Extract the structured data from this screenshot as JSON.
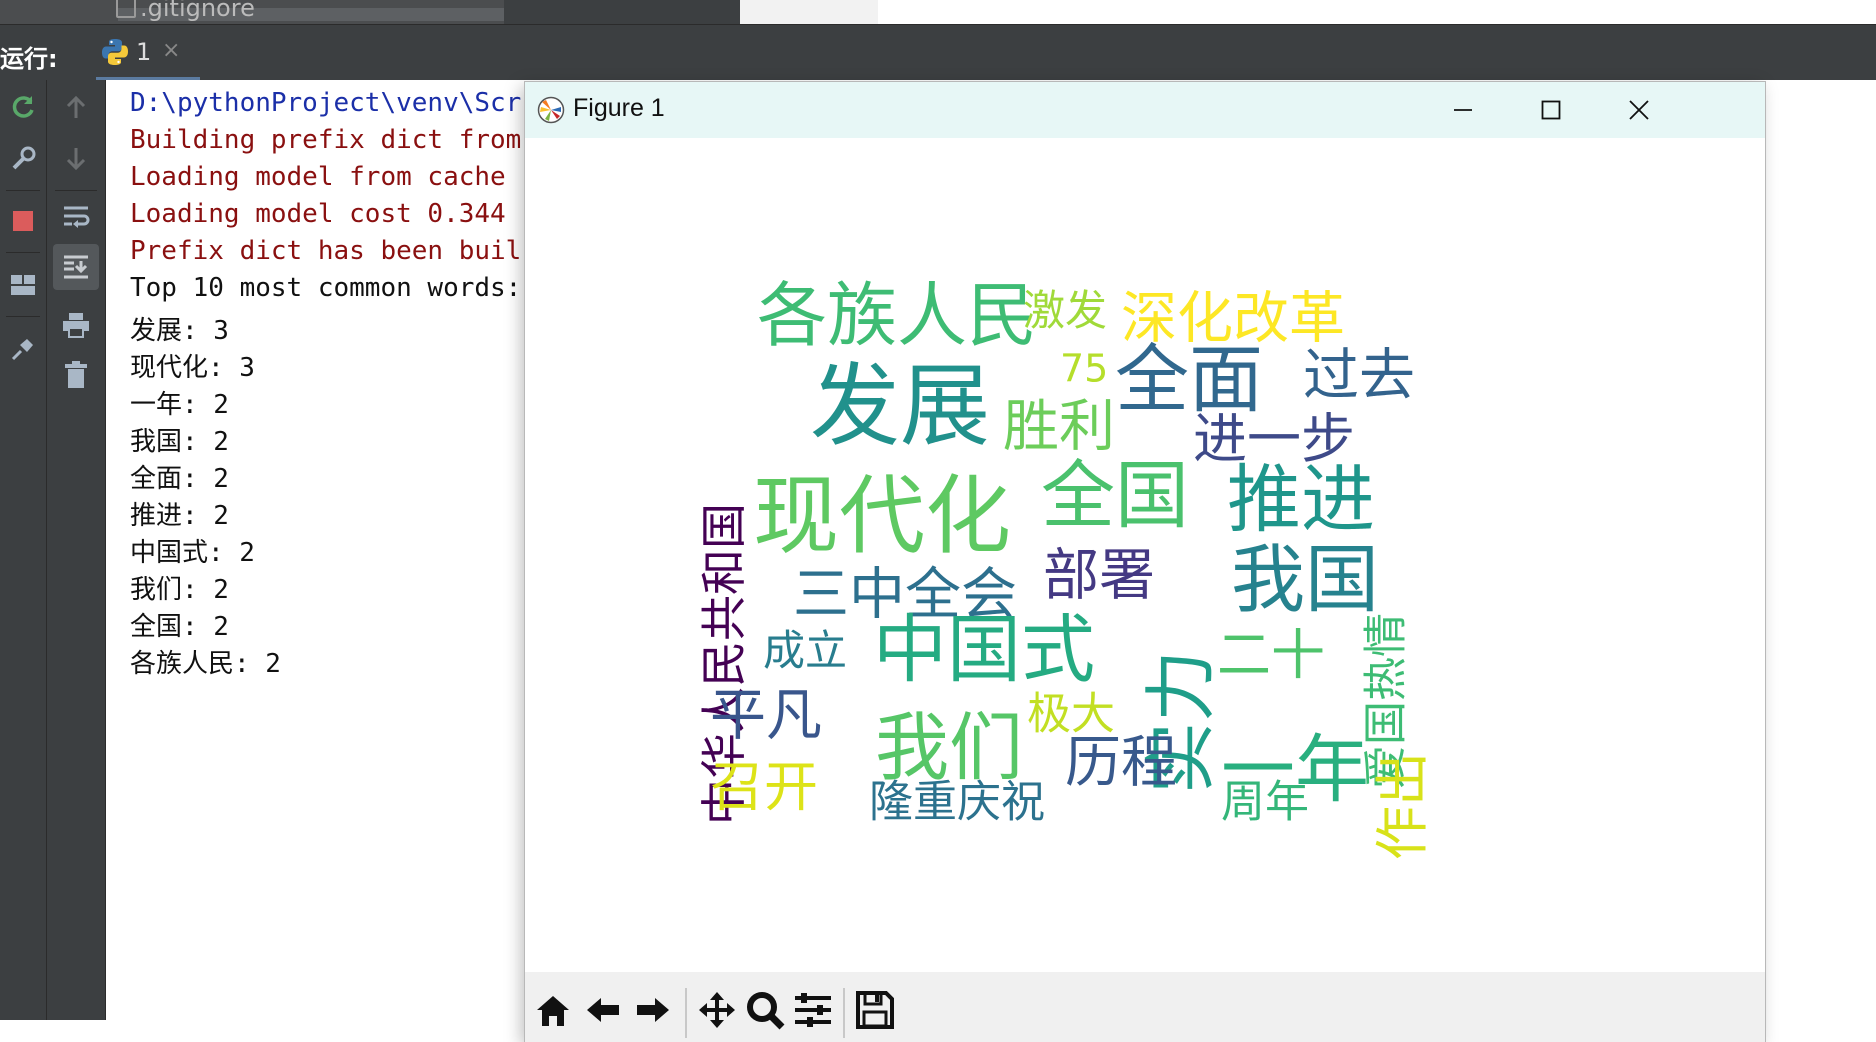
{
  "project_tree": {
    "file_name": ".gitignore"
  },
  "run_panel": {
    "label": "运行:",
    "tab_label": "1",
    "tab_close": "×"
  },
  "console": {
    "lines": [
      {
        "text": "D:\\pythonProject\\venv\\Scr",
        "color": "blue"
      },
      {
        "text": "Building prefix dict from",
        "color": "red"
      },
      {
        "text": "Loading model from cache",
        "color": "red"
      },
      {
        "text": "Loading model cost 0.344",
        "color": "red"
      },
      {
        "text": "Prefix dict has been buil",
        "color": "red"
      },
      {
        "text": "Top 10 most common words:",
        "color": "black"
      },
      {
        "text": "发展: 3",
        "color": "black"
      },
      {
        "text": "现代化: 3",
        "color": "black"
      },
      {
        "text": "一年: 2",
        "color": "black"
      },
      {
        "text": "我国: 2",
        "color": "black"
      },
      {
        "text": "全面: 2",
        "color": "black"
      },
      {
        "text": "推进: 2",
        "color": "black"
      },
      {
        "text": "中国式: 2",
        "color": "black"
      },
      {
        "text": "我们: 2",
        "color": "black"
      },
      {
        "text": "全国: 2",
        "color": "black"
      },
      {
        "text": "各族人民: 2",
        "color": "black"
      }
    ]
  },
  "figure_window": {
    "title": "Figure 1",
    "controls": [
      "minimize-icon",
      "maximize-icon",
      "close-icon"
    ],
    "toolbar": [
      "home-icon",
      "back-arrow-icon",
      "forward-arrow-icon",
      "pan-icon",
      "zoom-icon",
      "configure-subplots-icon",
      "save-icon"
    ]
  },
  "wordcloud": {
    "words": [
      {
        "text": "各族人民",
        "color": "#3ebc74"
      },
      {
        "text": "激发",
        "color": "#a0da39"
      },
      {
        "text": "深化改革",
        "color": "#fde725"
      },
      {
        "text": "75",
        "color": "#b5de2b"
      },
      {
        "text": "发展",
        "color": "#21918c"
      },
      {
        "text": "全面",
        "color": "#31688e"
      },
      {
        "text": "过去",
        "color": "#33638d"
      },
      {
        "text": "胜利",
        "color": "#6ccd5a"
      },
      {
        "text": "进一步",
        "color": "#3e4a89"
      },
      {
        "text": "中华人民共和国",
        "color": "#440154"
      },
      {
        "text": "现代化",
        "color": "#5ec962"
      },
      {
        "text": "全国",
        "color": "#4ac16d"
      },
      {
        "text": "推进",
        "color": "#1f968b"
      },
      {
        "text": "爱国热情",
        "color": "#3dbc74"
      },
      {
        "text": "三中全会",
        "color": "#2d708e"
      },
      {
        "text": "部署",
        "color": "#443983"
      },
      {
        "text": "我国",
        "color": "#26828e"
      },
      {
        "text": "实力",
        "color": "#1f9e89"
      },
      {
        "text": "成立",
        "color": "#287d8e"
      },
      {
        "text": "中国式",
        "color": "#25ab82"
      },
      {
        "text": "二十",
        "color": "#4ec36b"
      },
      {
        "text": "作出",
        "color": "#d8e219"
      },
      {
        "text": "平凡",
        "color": "#39568c"
      },
      {
        "text": "极大",
        "color": "#c2df23"
      },
      {
        "text": "我们",
        "color": "#56c667"
      },
      {
        "text": "历程",
        "color": "#38598c"
      },
      {
        "text": "一年",
        "color": "#29af7f"
      },
      {
        "text": "召开",
        "color": "#dde318"
      },
      {
        "text": "隆重庆祝",
        "color": "#2c728e"
      },
      {
        "text": "周年",
        "color": "#34b679"
      }
    ]
  }
}
